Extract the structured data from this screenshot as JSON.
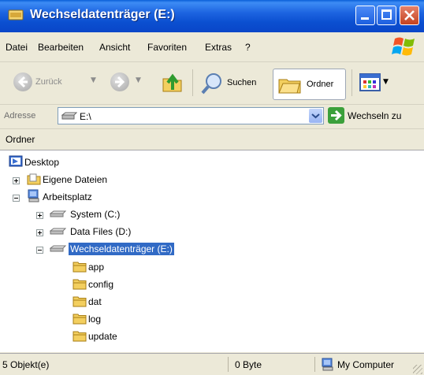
{
  "window": {
    "title": "Wechseldatenträger (E:)"
  },
  "menu": [
    "Datei",
    "Bearbeiten",
    "Ansicht",
    "Favoriten",
    "Extras",
    "?"
  ],
  "toolbar": {
    "back_label": "Zurück",
    "search_label": "Suchen",
    "folders_label": "Ordner"
  },
  "address": {
    "label": "Adresse",
    "value": "E:\\",
    "go_label": "Wechseln zu"
  },
  "folder_pane": {
    "title": "Ordner",
    "tree": {
      "desktop": "Desktop",
      "my_documents": "Eigene Dateien",
      "my_computer": "Arbeitsplatz",
      "system": "System (C:)",
      "data_files": "Data Files (D:)",
      "removable": "Wechseldatenträger (E:)",
      "folders": [
        "app",
        "config",
        "dat",
        "log",
        "update"
      ]
    }
  },
  "status": {
    "objects": "5 Objekt(e)",
    "size": "0 Byte",
    "zone": "My Computer"
  }
}
